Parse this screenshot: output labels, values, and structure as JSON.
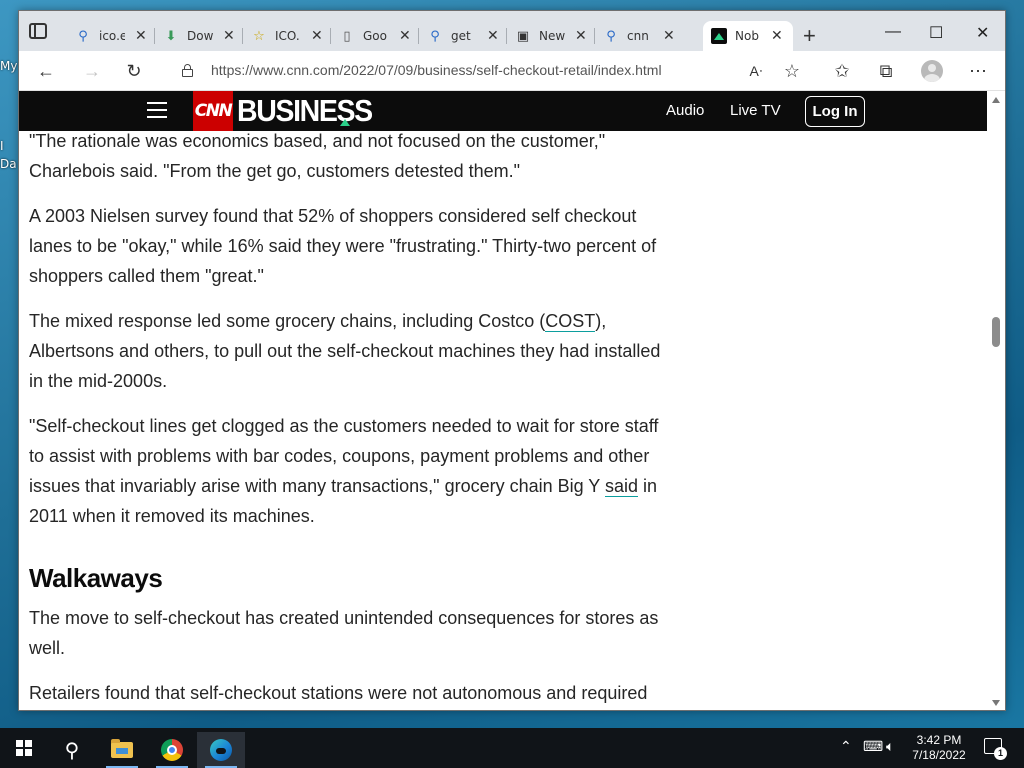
{
  "desktop": {
    "icon_labels": [
      "My",
      "I",
      "Da"
    ]
  },
  "browser": {
    "tabs": [
      {
        "label": "ico.e",
        "icon": "search-icon"
      },
      {
        "label": "Dow",
        "icon": "download-icon"
      },
      {
        "label": "ICO.",
        "icon": "star-icon"
      },
      {
        "label": "Goo",
        "icon": "document-icon"
      },
      {
        "label": "get",
        "icon": "search-icon"
      },
      {
        "label": "New",
        "icon": "new-tab-icon"
      },
      {
        "label": "cnn",
        "icon": "search-icon"
      },
      {
        "label": "Nob",
        "icon": "cnn-business-icon",
        "active": true
      }
    ],
    "new_tab_glyph": "+",
    "window_controls": {
      "minimize": "—",
      "maximize": "☐",
      "close": "✕"
    },
    "url": "https://www.cnn.com/2022/07/09/business/self-checkout-retail/index.html",
    "toolbar_icons": [
      "back-icon",
      "forward-icon",
      "refresh-icon",
      "lock-icon",
      "read-aloud-icon",
      "add-favorite-icon",
      "favorites-icon",
      "collections-icon",
      "profile-icon",
      "more-icon"
    ]
  },
  "cnn_header": {
    "logo_cnn": "CNN",
    "logo_business": "BUSINESS",
    "nav": [
      "Audio",
      "Live TV"
    ],
    "login": "Log In",
    "colors": {
      "bar": "#0c0c0c",
      "logo_red": "#cc0000",
      "accent": "#2bd18a"
    }
  },
  "article": {
    "p1": "\"The rationale was economics based, and not focused on the customer,\" Charlebois said. \"From the get go, customers detested them.\"",
    "p2": "A 2003 Nielsen survey found that 52% of shoppers considered self checkout lanes to be \"okay,\" while 16% said they were \"frustrating.\" Thirty-two percent of shoppers called them \"great.\"",
    "p3_before": "The mixed response led some grocery chains, including Costco (",
    "p3_link": "COST",
    "p3_after": "), Albertsons and others, to pull out the self-checkout machines they had installed in the mid-2000s.",
    "p4_before": "\"Self-checkout lines get clogged as the customers needed to wait for store staff to assist with problems with bar codes, coupons, payment problems and other issues that invariably arise with many transactions,\" grocery chain Big Y ",
    "p4_link": "said",
    "p4_after": " in 2011 when it removed its machines.",
    "heading": "Walkaways",
    "p5": "The move to self-checkout has created unintended consequences for stores as well.",
    "p6": "Retailers found that self-checkout stations were not autonomous and required"
  },
  "taskbar": {
    "apps": [
      "search-icon",
      "file-explorer-icon",
      "chrome-icon",
      "edge-icon"
    ],
    "clock_time": "3:42 PM",
    "clock_date": "7/18/2022",
    "notification_count": "1"
  }
}
